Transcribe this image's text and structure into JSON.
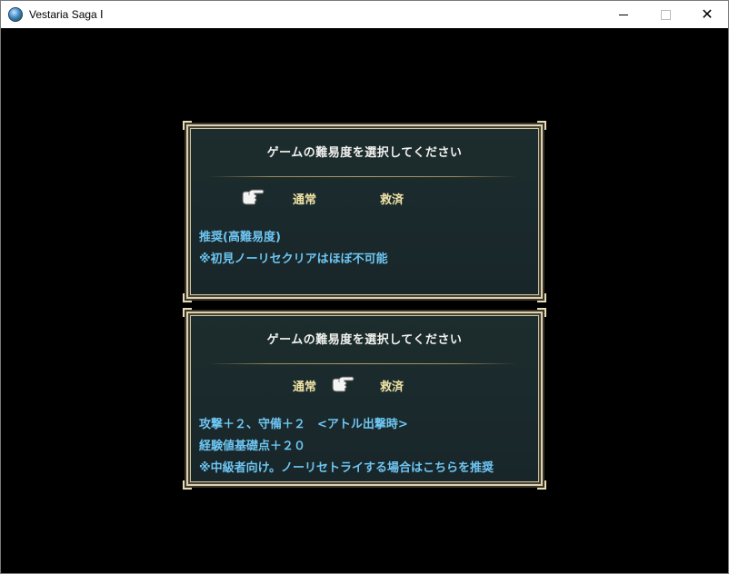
{
  "window": {
    "title": "Vestaria Saga Ⅰ",
    "icon": "globe-icon",
    "controls": [
      "minimize",
      "maximize",
      "close"
    ]
  },
  "panels": [
    {
      "title": "ゲームの難易度を選択してください",
      "options": [
        "通常",
        "救済"
      ],
      "cursor_on": "通常",
      "description": [
        "推奨(高難易度)",
        "※初見ノーリセクリアはほぼ不可能"
      ]
    },
    {
      "title": "ゲームの難易度を選択してください",
      "options": [
        "通常",
        "救済"
      ],
      "cursor_on": "救済",
      "description": [
        "攻撃＋２、守備＋２　<アトル出撃時>",
        "経験値基礎点＋２０",
        "※中級者向け。ノーリセトライする場合はこちらを推奨"
      ]
    }
  ],
  "colors": {
    "panel_bg": "#1b2a2a",
    "title_text": "#f1f1ee",
    "option_text": "#efe2a6",
    "description_text": "#6ec5f2",
    "frame": "#d9d2b8"
  }
}
